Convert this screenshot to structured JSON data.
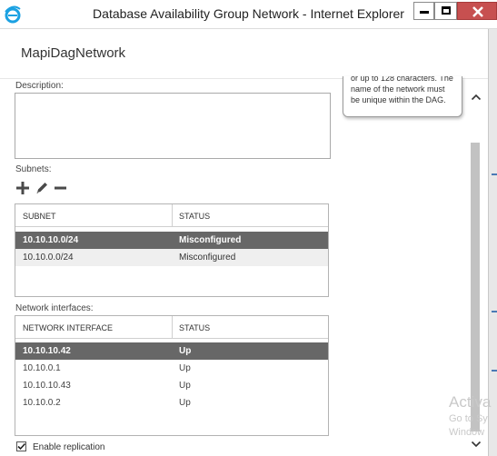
{
  "window": {
    "title": "Database Availability Group Network - Internet Explorer",
    "accent": "#1ba1e2",
    "close_color": "#c75050"
  },
  "page": {
    "title": "MapiDagNetwork"
  },
  "description": {
    "label": "Description:",
    "value": ""
  },
  "tooltip": {
    "lines": [
      "or up to 128 characters. The",
      "name of the network must",
      "be unique within the DAG."
    ]
  },
  "subnets": {
    "label": "Subnets:",
    "toolbar": {
      "add": "add",
      "edit": "edit",
      "remove": "remove"
    },
    "columns": [
      "SUBNET",
      "STATUS"
    ],
    "rows": [
      {
        "subnet": "10.10.10.0/24",
        "status": "Misconfigured",
        "selected": true
      },
      {
        "subnet": "10.10.0.0/24",
        "status": "Misconfigured",
        "selected": false
      }
    ]
  },
  "interfaces": {
    "label": "Network interfaces:",
    "columns": [
      "NETWORK INTERFACE",
      "STATUS"
    ],
    "rows": [
      {
        "name": "10.10.10.42",
        "status": "Up",
        "selected": true
      },
      {
        "name": "10.10.0.1",
        "status": "Up",
        "selected": false
      },
      {
        "name": "10.10.10.43",
        "status": "Up",
        "selected": false
      },
      {
        "name": "10.10.0.2",
        "status": "Up",
        "selected": false
      }
    ]
  },
  "replication": {
    "label": "Enable replication",
    "checked": true
  },
  "watermark": {
    "line1": "Activa",
    "line2": "Go to Sy",
    "line3": "Window"
  }
}
